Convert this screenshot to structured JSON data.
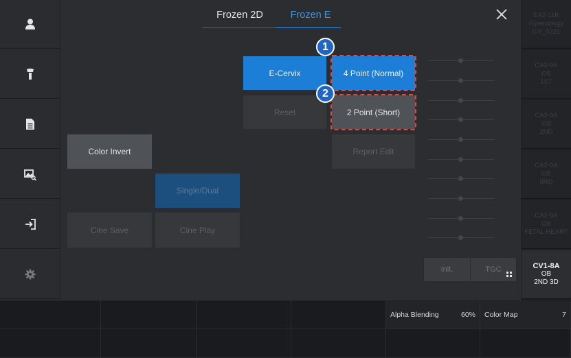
{
  "tabs": [
    {
      "label": "Frozen 2D",
      "active": false
    },
    {
      "label": "Frozen E",
      "active": true
    }
  ],
  "close_label": "×",
  "buttons": {
    "e_cervix": "E-Cervix",
    "four_point": "4 Point (Normal)",
    "reset": "Reset",
    "two_point": "2 Point (Short)",
    "report_edit": "Report Edit",
    "color_invert": "Color Invert",
    "single_dual": "Single/Dual",
    "cine_save": "Cine Save",
    "cine_play": "Cine Play",
    "init": "Init.",
    "tgc": "TGC"
  },
  "badges": [
    "1",
    "2"
  ],
  "left_nav": [
    {
      "icon": "user-icon"
    },
    {
      "icon": "probe-icon"
    },
    {
      "icon": "document-icon"
    },
    {
      "icon": "image-search-icon"
    },
    {
      "icon": "exit-icon"
    },
    {
      "icon": "gear-icon"
    }
  ],
  "presets": [
    {
      "line1": "EA2-11B",
      "line2": "Gynecology",
      "line3": "GY_0221",
      "active": false
    },
    {
      "line1": "CA2-9A",
      "line2": "OB",
      "line3": "1ST",
      "active": false
    },
    {
      "line1": "CA2-9A",
      "line2": "OB",
      "line3": "2ND",
      "active": false
    },
    {
      "line1": "CA2-9A",
      "line2": "OB",
      "line3": "3RD",
      "active": false
    },
    {
      "line1": "CA2-9A",
      "line2": "OB",
      "line3": "FETAL HEART",
      "active": false
    },
    {
      "line1": "CV1-8A",
      "line2": "OB",
      "line3": "2ND 3D",
      "active": true
    }
  ],
  "bottom_row1": [
    {
      "label": "",
      "value": ""
    },
    {
      "label": "",
      "value": ""
    },
    {
      "label": "",
      "value": ""
    },
    {
      "label": "",
      "value": ""
    },
    {
      "label": "Alpha Blending",
      "value": "60%"
    },
    {
      "label": "Color Map",
      "value": "7"
    }
  ],
  "bottom_row2": [
    {
      "label": "",
      "value": ""
    },
    {
      "label": "",
      "value": ""
    },
    {
      "label": "",
      "value": ""
    },
    {
      "label": "",
      "value": ""
    },
    {
      "label": "",
      "value": ""
    },
    {
      "label": "",
      "value": ""
    }
  ],
  "colors": {
    "accent_blue": "#1c7ed6",
    "highlight_red": "#e8453c",
    "badge_blue": "#1f67c6"
  }
}
